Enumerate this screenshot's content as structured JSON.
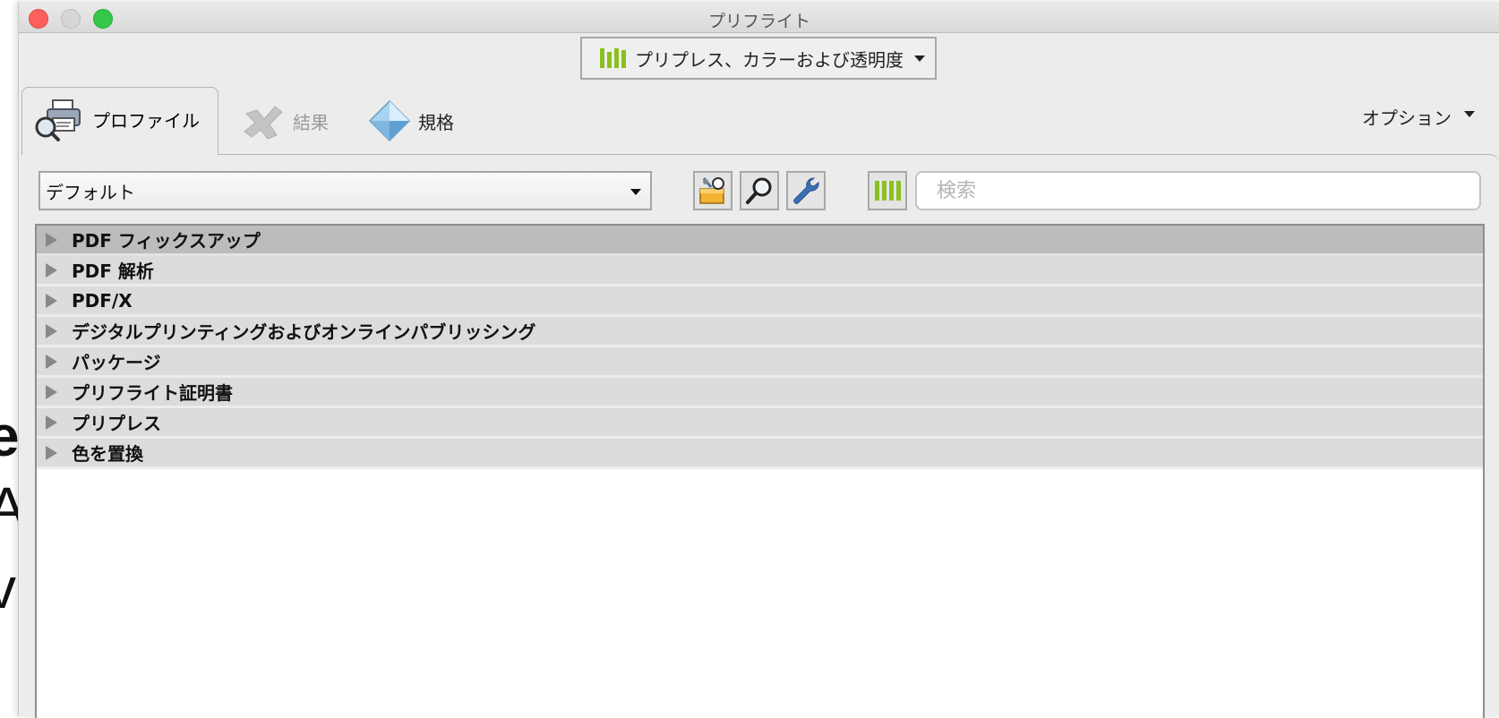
{
  "window": {
    "title": "プリフライト"
  },
  "mode_button": {
    "label": "プリプレス、カラーおよび透明度",
    "icon": "bars-chart-icon"
  },
  "tabs": [
    {
      "label": "プロファイル",
      "icon": "printer-magnifier-icon",
      "active": true
    },
    {
      "label": "結果",
      "icon": "x-mark-icon",
      "enabled": false
    },
    {
      "label": "規格",
      "icon": "diamond-icon"
    }
  ],
  "options": {
    "label": "オプション"
  },
  "profile_select": {
    "value": "デフォルト"
  },
  "toolbar": {
    "icons": [
      "fixup-toolbox-icon",
      "magnifier-icon",
      "wrench-icon",
      "bars-chart-icon"
    ]
  },
  "search": {
    "placeholder": "検索",
    "value": ""
  },
  "tree": {
    "items": [
      {
        "label": "PDF フィックスアップ",
        "selected": true
      },
      {
        "label": "PDF 解析"
      },
      {
        "label": "PDF/X"
      },
      {
        "label": "デジタルプリンティングおよびオンラインパブリッシング"
      },
      {
        "label": "パッケージ"
      },
      {
        "label": "プリフライト証明書"
      },
      {
        "label": "プリプレス"
      },
      {
        "label": "色を置換"
      }
    ]
  },
  "background_text": [
    "e",
    "A",
    "v"
  ],
  "colors": {
    "accent_green": "#8cbf1f",
    "selected_row": "#bcbcbc",
    "row": "#dcdcdc"
  }
}
